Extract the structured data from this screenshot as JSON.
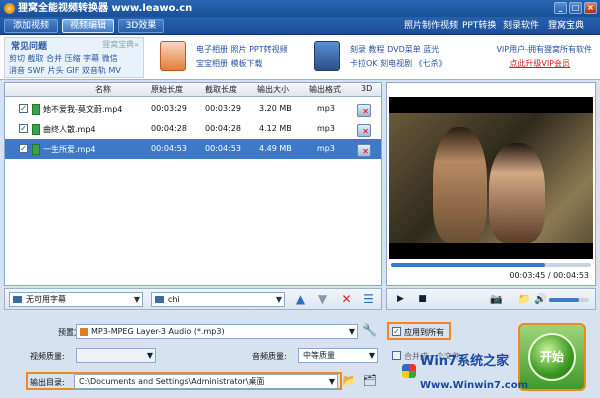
{
  "window": {
    "title": "狸窝全能视频转换器 www.leawo.cn"
  },
  "toolbar": {
    "tabs": [
      {
        "label": "添加视频"
      },
      {
        "label": "视频编辑"
      },
      {
        "label": "3D效果"
      }
    ],
    "links": [
      {
        "label": "照片制作视频"
      },
      {
        "label": "PPT转换"
      },
      {
        "label": "刻录软件"
      },
      {
        "label": "狸窝宝典"
      }
    ]
  },
  "ad": {
    "faq_title": "常见问题",
    "faq_sub": "狸窝宝典»",
    "faq_line1": "剪切 截取 合并 压缩 字幕 微信",
    "faq_line2": "消音 SWF 片头 GIF 双音轨 MV",
    "mid_line1": "电子相册 照片 PPT转视频",
    "mid_line2": "宝宝相册 模板下载",
    "dvd_line1": "刻录 教程 DVD菜单 蓝光",
    "dvd_line2": "卡拉OK 刻电视剧 《七杀》",
    "vip_line1": "VIP用户-拥有狸窝所有软件",
    "vip_line2": "点此升级VIP会员"
  },
  "filelist": {
    "headers": {
      "name": "名称",
      "orig_len": "原始长度",
      "cut_len": "截取长度",
      "out_size": "输出大小",
      "out_fmt": "输出格式",
      "threed": "3D"
    },
    "rows": [
      {
        "name": "她不爱我-莫文蔚.mp4",
        "orig": "00:03:29",
        "cut": "00:03:29",
        "size": "3.20 MB",
        "fmt": "mp3",
        "checked": true
      },
      {
        "name": "曲终人散.mp4",
        "orig": "00:04:28",
        "cut": "00:04:28",
        "size": "4.12 MB",
        "fmt": "mp3",
        "checked": true
      },
      {
        "name": "一生所爱.mp4",
        "orig": "00:04:53",
        "cut": "00:04:53",
        "size": "4.49 MB",
        "fmt": "mp3",
        "checked": true
      }
    ]
  },
  "listbar": {
    "subtitle": "无可用字幕",
    "audio_track": "chi"
  },
  "preview": {
    "time": "00:03:45 / 00:04:53",
    "progress": 0.77,
    "volume": 0.75
  },
  "settings": {
    "preset_label": "预置方案:",
    "preset_value": "MP3-MPEG Layer-3 Audio (*.mp3)",
    "apply_all": "应用到所有",
    "video_quality_label": "视频质量:",
    "video_quality_value": "",
    "audio_quality_label": "音频质量:",
    "audio_quality_value": "中等质量",
    "merge_label": "合并成一个文件",
    "output_label": "输出目录:",
    "output_value": "C:\\Documents and Settings\\Administrator\\桌面",
    "convert_label": "开始"
  },
  "watermark": {
    "line1": "Win7系统之家",
    "line2": "Www.Winwin7.com"
  },
  "colors": {
    "accent": "#3d79c8",
    "highlight": "#f08a1c",
    "convert": "#3f9a2a"
  }
}
